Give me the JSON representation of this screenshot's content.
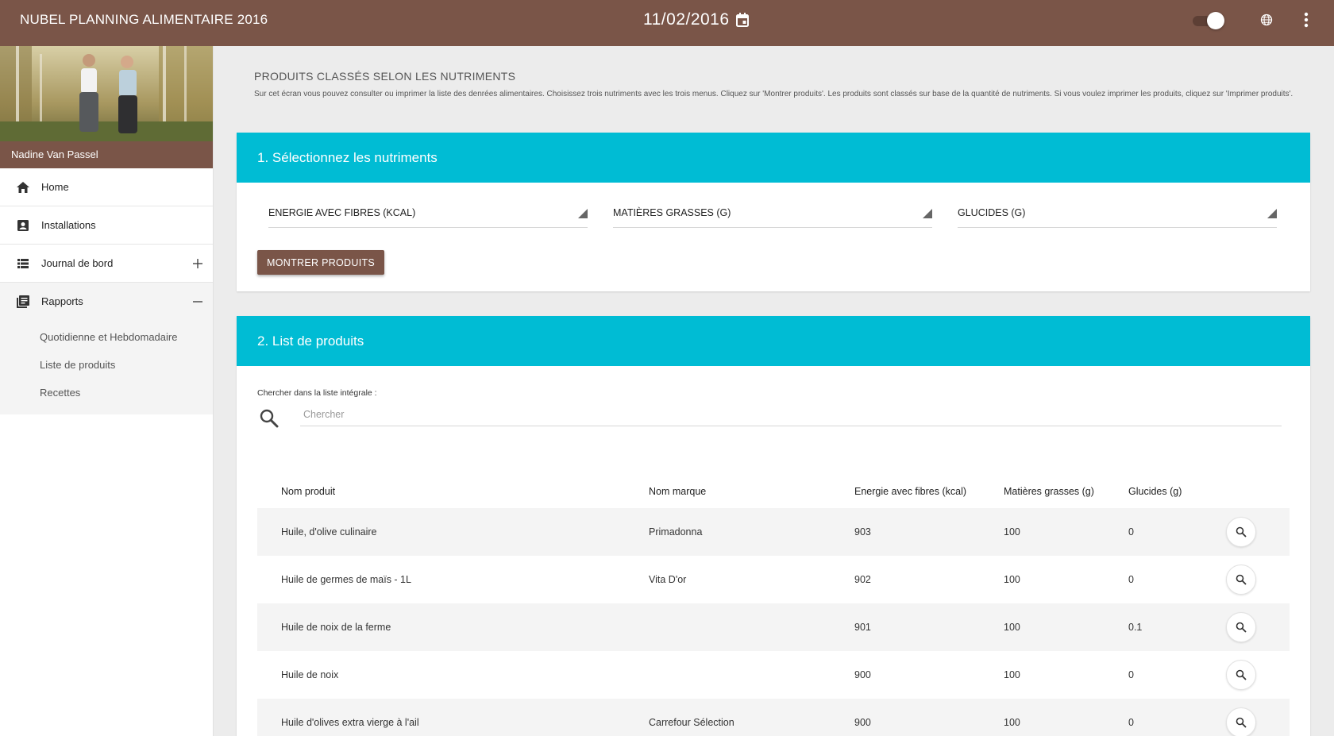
{
  "header": {
    "app_title": "NUBEL PLANNING ALIMENTAIRE 2016",
    "date": "11/02/2016"
  },
  "sidebar": {
    "user_name": "Nadine Van Passel",
    "items": [
      {
        "label": "Home",
        "icon": "home-icon"
      },
      {
        "label": "Installations",
        "icon": "contact-card-icon"
      },
      {
        "label": "Journal de bord",
        "icon": "list-icon",
        "expand": "+"
      },
      {
        "label": "Rapports",
        "icon": "report-icon",
        "expand": "−"
      }
    ],
    "subitems": [
      "Quotidienne et Hebdomadaire",
      "Liste de produits",
      "Recettes"
    ]
  },
  "page": {
    "title": "PRODUITS CLASSÉS SELON LES NUTRIMENTS",
    "description": "Sur cet écran vous pouvez consulter ou imprimer la liste des denrées alimentaires. Choisissez trois nutriments avec les trois menus. Cliquez sur 'Montrer produits'. Les produits sont classés sur base de la quantité de nutriments. Si vous voulez imprimer les produits, cliquez sur 'Imprimer produits'."
  },
  "section1": {
    "title": "1. Sélectionnez les nutriments",
    "selects": [
      "ENERGIE AVEC FIBRES (KCAL)",
      "MATIÈRES GRASSES (G)",
      "GLUCIDES (G)"
    ],
    "button_label": "MONTRER PRODUITS"
  },
  "section2": {
    "title": "2. List de produits",
    "search_label": "Chercher dans la liste intégrale :",
    "search_placeholder": "Chercher",
    "columns": [
      "Nom produit",
      "Nom marque",
      "Energie avec fibres (kcal)",
      "Matières grasses (g)",
      "Glucides (g)"
    ],
    "rows": [
      [
        "Huile, d'olive culinaire",
        "Primadonna",
        "903",
        "100",
        "0"
      ],
      [
        "Huile de germes de maïs - 1L",
        "Vita D'or",
        "902",
        "100",
        "0"
      ],
      [
        "Huile de noix de la ferme",
        "",
        "901",
        "100",
        "0.1"
      ],
      [
        "Huile de noix",
        "",
        "900",
        "100",
        "0"
      ],
      [
        "Huile d'olives extra vierge à l'ail",
        "Carrefour Sélection",
        "900",
        "100",
        "0"
      ]
    ]
  },
  "colors": {
    "brown": "#7a5548",
    "cyan": "#00bcd4"
  }
}
